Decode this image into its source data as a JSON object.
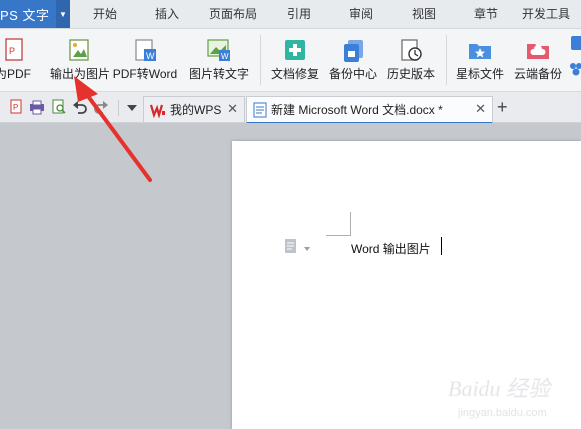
{
  "app": {
    "title": "PS 文字"
  },
  "menu_tabs": [
    "开始",
    "插入",
    "页面布局",
    "引用",
    "审阅",
    "视图",
    "章节",
    "开发工具"
  ],
  "ribbon": {
    "buttons": [
      "为PDF",
      "输出为图片",
      "PDF转Word",
      "图片转文字",
      "文档修复",
      "备份中心",
      "历史版本",
      "星标文件",
      "云端备份"
    ]
  },
  "tabs": {
    "wps_home": "我的WPS",
    "document": "新建 Microsoft Word 文档.docx *",
    "add": "+"
  },
  "document": {
    "text": "Word 输出图片"
  },
  "watermark": {
    "brand": "Baidu 经验",
    "url": "jingyan.baidu.com"
  },
  "colors": {
    "accent": "#3877c8",
    "arrow": "#e5322d",
    "wps_red": "#d9282a"
  }
}
